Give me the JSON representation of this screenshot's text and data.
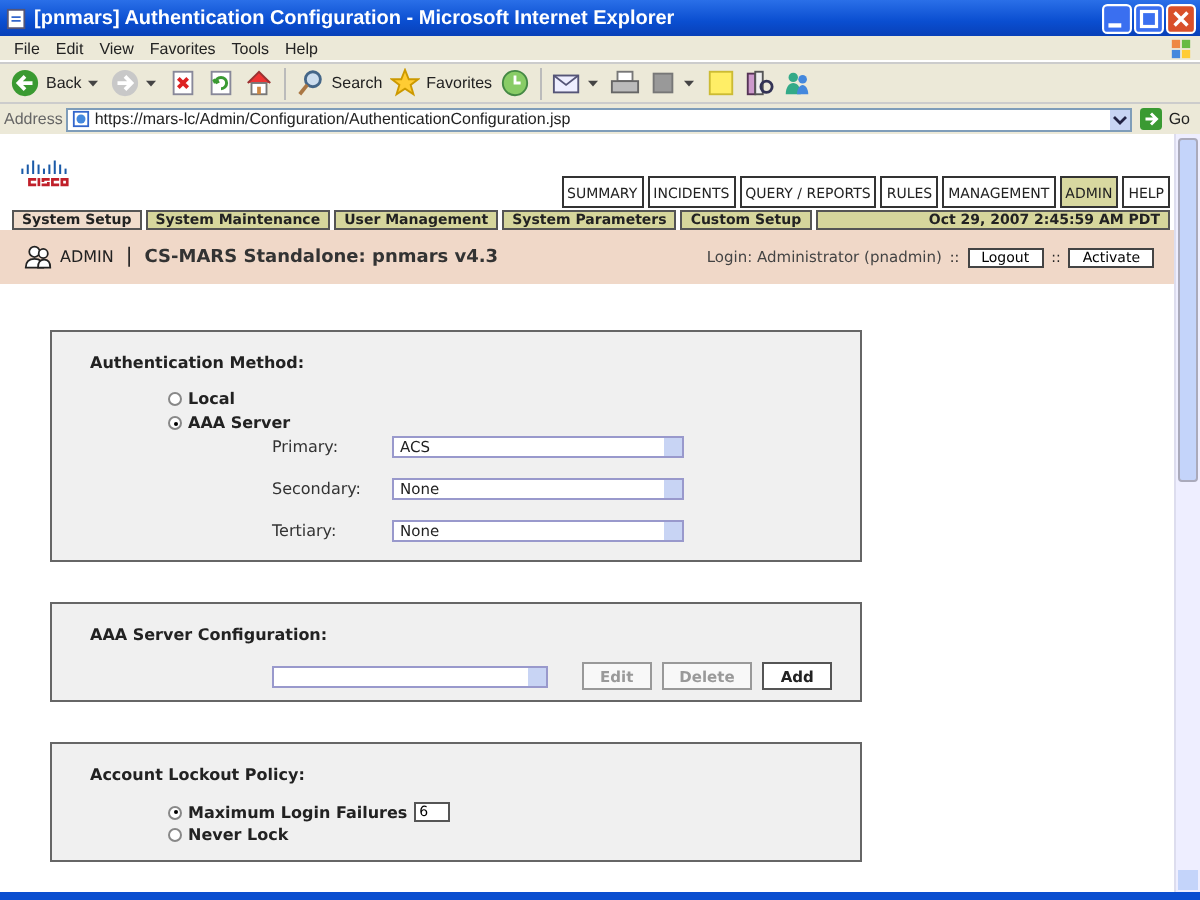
{
  "window": {
    "title": "[pnmars] Authentication Configuration - Microsoft Internet Explorer"
  },
  "menu": [
    "File",
    "Edit",
    "View",
    "Favorites",
    "Tools",
    "Help"
  ],
  "toolbar": [
    {
      "kind": "back",
      "label": "Back",
      "dropdown": true
    },
    {
      "kind": "forward",
      "dropdown": true
    },
    {
      "kind": "stop",
      "dropdown": false
    },
    {
      "kind": "refresh",
      "dropdown": false
    },
    {
      "kind": "home",
      "dropdown": false
    },
    {
      "kind": "search",
      "label": "Search",
      "dropdown": false
    },
    {
      "kind": "favorites",
      "label": "Favorites",
      "dropdown": false
    },
    {
      "kind": "history",
      "dropdown": false
    },
    {
      "kind": "mail",
      "dropdown": true
    },
    {
      "kind": "print",
      "dropdown": false
    },
    {
      "kind": "edit",
      "dropdown": true
    },
    {
      "kind": "notes",
      "dropdown": false
    },
    {
      "kind": "research",
      "dropdown": false
    },
    {
      "kind": "messenger",
      "dropdown": false
    }
  ],
  "address": {
    "label": "Address",
    "value": "https://mars-lc/Admin/Configuration/AuthenticationConfiguration.jsp",
    "go": "Go"
  },
  "nav_tabs": [
    {
      "label": "SUMMARY",
      "selected": false
    },
    {
      "label": "INCIDENTS",
      "selected": false
    },
    {
      "label": "QUERY / REPORTS",
      "selected": false
    },
    {
      "label": "RULES",
      "selected": false
    },
    {
      "label": "MANAGEMENT",
      "selected": false
    },
    {
      "label": "ADMIN",
      "selected": true
    },
    {
      "label": "HELP",
      "selected": false
    }
  ],
  "sub_tabs": [
    {
      "label": "System Setup",
      "selected": true
    },
    {
      "label": "System Maintenance",
      "selected": false
    },
    {
      "label": "User Management",
      "selected": false
    },
    {
      "label": "System Parameters",
      "selected": false
    },
    {
      "label": "Custom Setup",
      "selected": false
    }
  ],
  "date": "Oct 29, 2007 2:45:59 AM PDT",
  "admin_bar": {
    "role": "ADMIN",
    "separator": "|",
    "product": "CS-MARS Standalone: pnmars v4.3",
    "login": "Login: Administrator (pnadmin)",
    "buttons": [
      {
        "label": "Logout",
        "separator": "::"
      },
      {
        "label": "Activate",
        "separator": "::"
      }
    ]
  },
  "auth_method": {
    "title": "Authentication Method:",
    "options": [
      {
        "label": "Local",
        "selected": false
      },
      {
        "label": "AAA Server",
        "selected": true
      }
    ],
    "servers": [
      {
        "label": "Primary:",
        "value": "ACS"
      },
      {
        "label": "Secondary:",
        "value": "None"
      },
      {
        "label": "Tertiary:",
        "value": "None"
      }
    ]
  },
  "aaa_config": {
    "title": "AAA Server Configuration:",
    "buttons": [
      {
        "label": "Edit",
        "disabled": true
      },
      {
        "label": "Delete",
        "disabled": true
      },
      {
        "label": "Add",
        "disabled": false
      }
    ]
  },
  "lockout": {
    "title": "Account Lockout Policy:",
    "options": [
      {
        "kind": "count",
        "label": "Maximum Login Failures",
        "value": "6",
        "selected": true
      },
      {
        "kind": "plain",
        "label": "Never Lock",
        "selected": false
      }
    ]
  }
}
